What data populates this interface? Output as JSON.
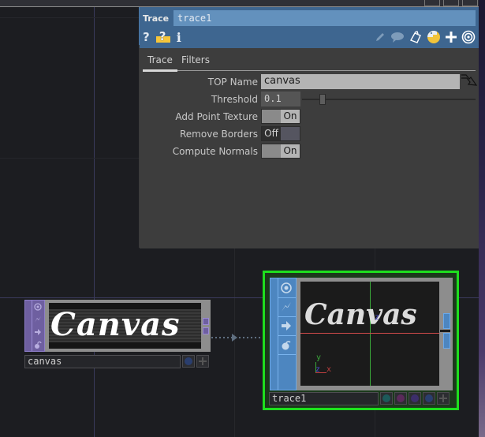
{
  "parameter_panel": {
    "op_type": "Trace",
    "op_name": "trace1",
    "header_icons_left": [
      "help-icon",
      "python-help-icon",
      "info-icon"
    ],
    "header_icons_right": [
      "edit-icon",
      "comment-icon",
      "clipboard-icon",
      "python-icon",
      "add-icon",
      "target-icon"
    ],
    "tabs": [
      {
        "label": "Trace",
        "active": true
      },
      {
        "label": "Filters",
        "active": false
      }
    ],
    "params": {
      "top_name": {
        "label": "TOP Name",
        "value": "canvas"
      },
      "threshold": {
        "label": "Threshold",
        "value": "0.1",
        "slider_fraction": 0.1
      },
      "add_point_texture": {
        "label": "Add Point Texture",
        "state": "On",
        "on_label": "On",
        "off_label": "Off"
      },
      "remove_borders": {
        "label": "Remove Borders",
        "state": "Off",
        "on_label": "On",
        "off_label": "Off"
      },
      "compute_normals": {
        "label": "Compute Normals",
        "state": "On",
        "on_label": "On",
        "off_label": "Off"
      }
    }
  },
  "nodes": {
    "canvas": {
      "name": "canvas",
      "family": "TOP",
      "family_color": "#7a6aa8",
      "viewer_text": "Canvas",
      "flag_icons": [
        "viewer-icon",
        "bypass-icon",
        "export-icon",
        "lock-icon"
      ]
    },
    "trace1": {
      "name": "trace1",
      "family": "SOP",
      "family_color": "#4d86c0",
      "selected": true,
      "selection_color": "#1ee01e",
      "viewer_text": "Canvas",
      "axis_labels": {
        "x": "x",
        "y": "y",
        "z": "z"
      },
      "flag_icons": [
        "viewer-icon",
        "bypass-icon",
        "export-icon",
        "lock-icon"
      ],
      "render_flags": [
        {
          "name": "display-flag",
          "color": "#1d5a5a"
        },
        {
          "name": "render-flag",
          "color": "#5a2a5a"
        },
        {
          "name": "template-flag",
          "color": "#3c2e6a"
        },
        {
          "name": "selectable-flag",
          "color": "#2a3e6e"
        }
      ]
    }
  },
  "connection": {
    "from": "canvas",
    "to": "trace1"
  }
}
